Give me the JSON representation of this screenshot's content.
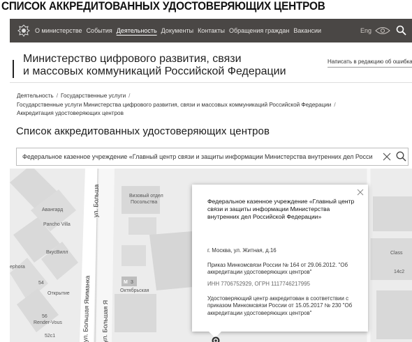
{
  "caption": "СПИСОК АККРЕДИТОВАННЫХ УДОСТОВЕРЯЮЩИХ ЦЕНТРОВ",
  "topnav": {
    "items": [
      {
        "label": "О министерстве",
        "active": false
      },
      {
        "label": "События",
        "active": false
      },
      {
        "label": "Деятельность",
        "active": true
      },
      {
        "label": "Документы",
        "active": false
      },
      {
        "label": "Контакты",
        "active": false
      },
      {
        "label": "Обращения граждан",
        "active": false
      },
      {
        "label": "Вакансии",
        "active": false
      }
    ],
    "lang": "Eng",
    "icons": [
      "emblem-icon",
      "eye-icon",
      "search-icon"
    ],
    "bg_color": "#4a4745"
  },
  "header": {
    "ministry_line1": "Министерство цифрового развития, связи",
    "ministry_line2": "и массовых коммуникаций Российской Федерации",
    "feedback_link": "Написать в редакцию об ошибках"
  },
  "breadcrumbs": {
    "items": [
      "Деятельность",
      "Государственные услуги",
      "Государственные услуги Министерства цифрового развития, связи и массовых коммуникаций Российской Федерации",
      "Аккредитация удостоверяющих центров"
    ]
  },
  "page_title": "Список аккредитованных удостоверяющих центров",
  "search": {
    "value": "Федеральное казенное учреждение «Главный центр связи и защиты информации Министерства внутренних дел Росси"
  },
  "map": {
    "labels": {
      "avangard": "Авангард",
      "pancho": "Pancho Villa",
      "vkusvill": "ВкусВилл",
      "otkrytie": "Открытие",
      "render": "Render-Vous",
      "b54": "54",
      "b56": "56",
      "b52c1": "52с1",
      "ephora": "ephora",
      "vizovoy1": "Визовый отдел",
      "vizovoy2": "Посольства",
      "oktyabrskaya": "Октябрьская",
      "metro": "М",
      "m3": "3",
      "class": "Class",
      "b14c2": "14с2",
      "yakimanka_left": "ул. Большая Якиманка",
      "bolshaya_top": "ул. Больша",
      "bolshaya_right": "ул. Большая Я",
      "yakimanka_mid": "ая Якиманка"
    }
  },
  "popup": {
    "title": "Федеральное казенное учреждение «Главный центр связи и защиты информации Министерства внутренних дел Российской Федерации»",
    "address": "г. Москва, ул. Житная, д.16",
    "order": "Приказ Минкомсвязи России № 164 от 29.06.2012. \"Об аккредитации удостоверяющих центров\"",
    "inn": "ИНН 7706752929, ОГРН 1117746217995",
    "accredited": "Удостоверяющий центр аккредитован в соответствии с приказом Минкомсвязи России от 15.05.2017 № 230 \"Об аккредитации удостоверяющих центров\""
  }
}
